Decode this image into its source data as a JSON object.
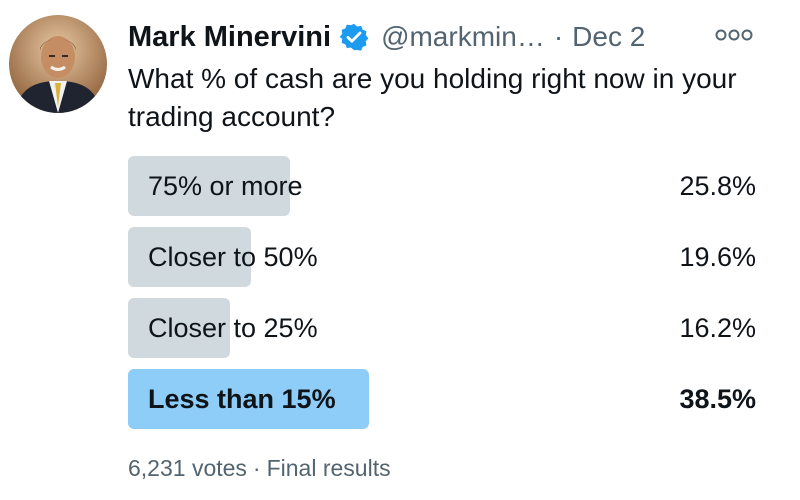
{
  "tweet": {
    "author_name": "Mark Minervini",
    "handle": "@markmin…",
    "separator": "·",
    "date": "Dec 2",
    "verified": true,
    "text": "What % of cash are you holding right now in your trading account?"
  },
  "poll": {
    "options": [
      {
        "label": "75% or more",
        "percent_text": "25.8%",
        "percent": 25.8,
        "winner": false
      },
      {
        "label": "Closer to 50%",
        "percent_text": "19.6%",
        "percent": 19.6,
        "winner": false
      },
      {
        "label": "Closer to 25%",
        "percent_text": "16.2%",
        "percent": 16.2,
        "winner": false
      },
      {
        "label": "Less than 15%",
        "percent_text": "38.5%",
        "percent": 38.5,
        "winner": true
      }
    ],
    "votes": "6,231 votes",
    "separator": "·",
    "status": "Final results"
  },
  "colors": {
    "verified": "#1d9bf0",
    "bar": "#cfd9de",
    "winner_bar": "#8ecdf8",
    "secondary_text": "#536471"
  },
  "icons": {
    "avatar": "profile-photo",
    "verified": "verified-badge-icon",
    "more": "more-options-icon"
  }
}
